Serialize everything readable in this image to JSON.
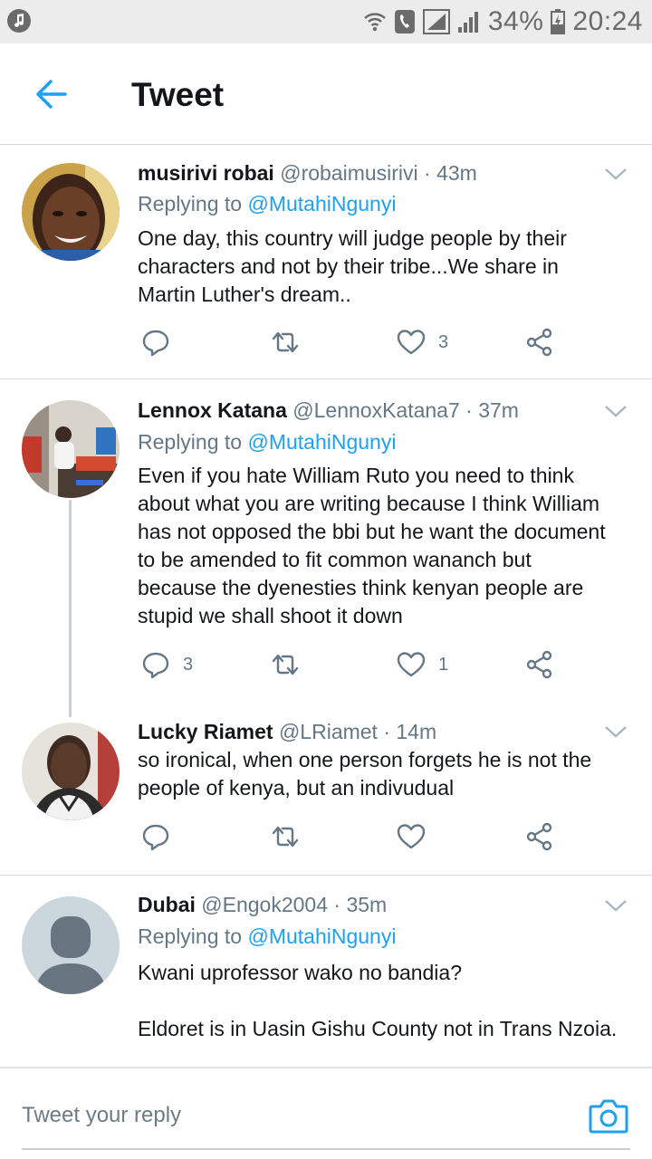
{
  "status_bar": {
    "battery": "34%",
    "time": "20:24",
    "icons": [
      "music-note-icon",
      "wifi-icon",
      "phone-icon",
      "signal-icon",
      "signal-icon",
      "battery-icon"
    ]
  },
  "header": {
    "title": "Tweet",
    "back_icon": "back-arrow-icon"
  },
  "tweets": [
    {
      "name": "musirivi robai",
      "meta": "@robaimusirivi · 43m",
      "replying_prefix": "Replying to",
      "replying_handle": "@MutahiNgunyi",
      "lines": [
        "One day, this country will judge people by their",
        "characters and not by their tribe...We share in",
        "Martin Luther's dream.."
      ],
      "reply_count": "",
      "retweet_count": "",
      "like_count": "3"
    },
    {
      "name": "Lennox Katana",
      "meta": "@LennoxKatana7 · 37m",
      "replying_prefix": "Replying to",
      "replying_handle": "@MutahiNgunyi",
      "lines": [
        "Even if you hate William Ruto you need to think",
        "about what you are writing because I think William",
        "has not opposed the bbi but he want the document",
        "to be amended to fit common  wananch but",
        "because the dyenesties think kenyan people are",
        "stupid we shall shoot it down"
      ],
      "reply_count": "3",
      "retweet_count": "",
      "like_count": "1"
    },
    {
      "name": "Lucky Riamet",
      "meta": "@LRiamet · 14m",
      "lines": [
        "so ironical, when one person forgets he is not the",
        "people of kenya, but an indivudual"
      ],
      "reply_count": "",
      "retweet_count": "",
      "like_count": ""
    },
    {
      "name": "Dubai",
      "meta": "@Engok2004 · 35m",
      "replying_prefix": "Replying to",
      "replying_handle": "@MutahiNgunyi",
      "lines": [
        "Kwani uprofessor wako no bandia?",
        "",
        "Eldoret is in Uasin Gishu County not in Trans Nzoia."
      ]
    }
  ],
  "reply_bar": {
    "placeholder": "Tweet your reply",
    "camera_icon": "camera-icon"
  },
  "colors": {
    "accent": "#1da1f2",
    "text": "#14171a",
    "secondary": "#657786",
    "divider": "#d8d8d8"
  }
}
